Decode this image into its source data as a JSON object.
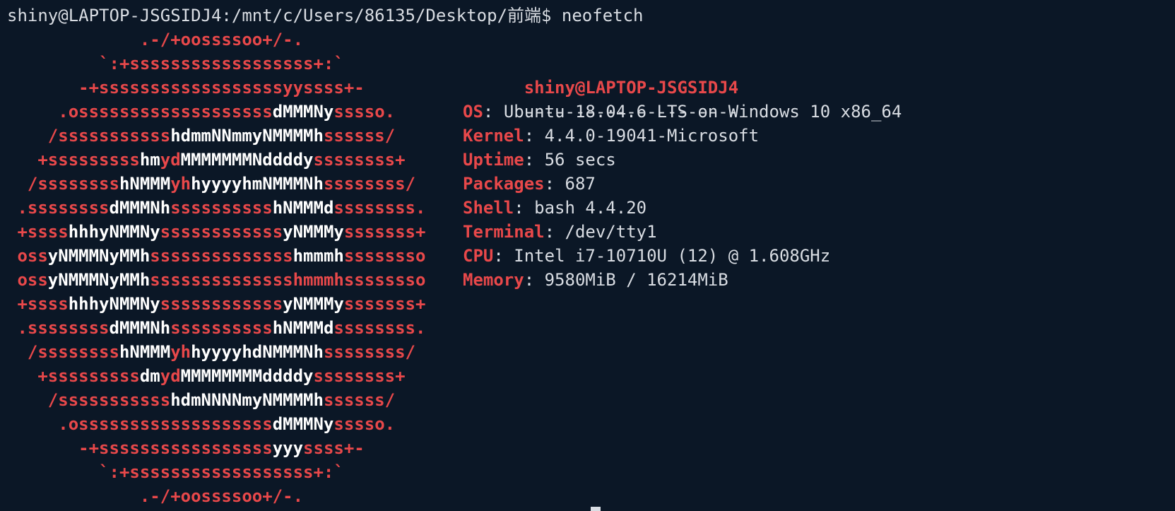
{
  "terminal": {
    "prompt_line": "shiny@LAPTOP-JSGSIDJ4:/mnt/c/Users/86135/Desktop/前端$ neofetch",
    "colors": {
      "red": "#e8484a",
      "white": "#ffffff",
      "text": "#d9dde3",
      "background": "#0b1726"
    }
  },
  "logo_lines": [
    [
      [
        "r",
        "             .-/+oossssoo+/-."
      ]
    ],
    [
      [
        "r",
        "         `:+ssssssssssssssssss+:`"
      ]
    ],
    [
      [
        "r",
        "       -+ssssssssssssssssssyyssss+-"
      ]
    ],
    [
      [
        "r",
        "     .osssssssssssssssssss"
      ],
      [
        "w",
        "dMMMNy"
      ],
      [
        "r",
        "sssso."
      ]
    ],
    [
      [
        "r",
        "    /sssssssssss"
      ],
      [
        "w",
        "hdmmNNmmyNMMMMh"
      ],
      [
        "r",
        "ssssss/"
      ]
    ],
    [
      [
        "r",
        "   +sssssssss"
      ],
      [
        "w",
        "hm"
      ],
      [
        "r",
        "yd"
      ],
      [
        "w",
        "MMMMMMMNddddy"
      ],
      [
        "r",
        "ssssssss+"
      ]
    ],
    [
      [
        "r",
        "  /ssssssss"
      ],
      [
        "w",
        "hNMMM"
      ],
      [
        "r",
        "yh"
      ],
      [
        "w",
        "hyyyyhmNMMMNh"
      ],
      [
        "r",
        "ssssssss/"
      ]
    ],
    [
      [
        "r",
        " .ssssssss"
      ],
      [
        "w",
        "dMMMNh"
      ],
      [
        "r",
        "ssssssssss"
      ],
      [
        "w",
        "hNMMMd"
      ],
      [
        "r",
        "ssssssss."
      ]
    ],
    [
      [
        "r",
        " +ssss"
      ],
      [
        "w",
        "hhhyNMMNy"
      ],
      [
        "r",
        "ssssssssssss"
      ],
      [
        "w",
        "yNMMMy"
      ],
      [
        "r",
        "sssssss+"
      ]
    ],
    [
      [
        "r",
        " oss"
      ],
      [
        "w",
        "yNMMMNyMMh"
      ],
      [
        "r",
        "ssssssssssssss"
      ],
      [
        "w",
        "hmmmh"
      ],
      [
        "r",
        "ssssssso"
      ]
    ],
    [
      [
        "r",
        " oss"
      ],
      [
        "w",
        "yNMMMNyMMh"
      ],
      [
        "r",
        "ssssssssssssss"
      ],
      [
        "r",
        "hmmmh"
      ],
      [
        "r",
        "ssssssso"
      ]
    ],
    [
      [
        "r",
        " +ssss"
      ],
      [
        "w",
        "hhhyNMMNy"
      ],
      [
        "r",
        "ssssssssssss"
      ],
      [
        "w",
        "yNMMMy"
      ],
      [
        "r",
        "sssssss+"
      ]
    ],
    [
      [
        "r",
        " .ssssssss"
      ],
      [
        "w",
        "dMMMNh"
      ],
      [
        "r",
        "ssssssssss"
      ],
      [
        "w",
        "hNMMMd"
      ],
      [
        "r",
        "ssssssss."
      ]
    ],
    [
      [
        "r",
        "  /ssssssss"
      ],
      [
        "w",
        "hNMMM"
      ],
      [
        "r",
        "yh"
      ],
      [
        "w",
        "hyyyyhdNMMMNh"
      ],
      [
        "r",
        "ssssssss/"
      ]
    ],
    [
      [
        "r",
        "   +sssssssss"
      ],
      [
        "w",
        "dm"
      ],
      [
        "r",
        "yd"
      ],
      [
        "w",
        "MMMMMMMMddddy"
      ],
      [
        "r",
        "ssssssss+"
      ]
    ],
    [
      [
        "r",
        "    /sssssssssss"
      ],
      [
        "w",
        "hdmNNNNmyNMMMMh"
      ],
      [
        "r",
        "ssssss/"
      ]
    ],
    [
      [
        "r",
        "     .osssssssssssssssssss"
      ],
      [
        "w",
        "dMMMNy"
      ],
      [
        "r",
        "sssso."
      ]
    ],
    [
      [
        "r",
        "       -+sssssssssssssssss"
      ],
      [
        "w",
        "yyy"
      ],
      [
        "r",
        "ssss+-"
      ]
    ],
    [
      [
        "r",
        "         `:+ssssssssssssssssss+:`"
      ]
    ],
    [
      [
        "r",
        "             .-/+oossssoo+/-."
      ]
    ]
  ],
  "info": {
    "user_host": "shiny@LAPTOP-JSGSIDJ4",
    "separator": "---------------------",
    "fields": [
      {
        "key": "OS",
        "value": "Ubuntu 18.04.6 LTS on Windows 10 x86_64"
      },
      {
        "key": "Kernel",
        "value": "4.4.0-19041-Microsoft"
      },
      {
        "key": "Uptime",
        "value": "56 secs"
      },
      {
        "key": "Packages",
        "value": "687"
      },
      {
        "key": "Shell",
        "value": "bash 4.4.20"
      },
      {
        "key": "Terminal",
        "value": "/dev/tty1"
      },
      {
        "key": "CPU",
        "value": "Intel i7-10710U (12) @ 1.608GHz"
      },
      {
        "key": "Memory",
        "value": "9580MiB / 16214MiB"
      }
    ]
  }
}
